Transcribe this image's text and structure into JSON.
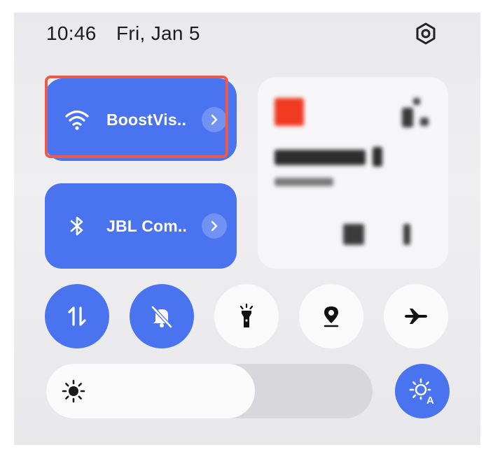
{
  "status": {
    "time": "10:46",
    "date": "Fri, Jan 5"
  },
  "icons": {
    "settings": "gear-icon",
    "wifi": "wifi-icon",
    "bluetooth": "bluetooth-icon",
    "data": "mobile-data-icon",
    "mute": "bell-off-icon",
    "flashlight": "flashlight-icon",
    "location": "location-pin-icon",
    "airplane": "airplane-icon",
    "brightness": "sun-icon",
    "auto_brightness": "auto-brightness-icon"
  },
  "tiles": {
    "wifi": {
      "label": "BoostVis.."
    },
    "bluetooth": {
      "label": "JBL Com.."
    }
  },
  "toggles": [
    {
      "name": "mobile-data",
      "active": true
    },
    {
      "name": "silent-mode",
      "active": true
    },
    {
      "name": "flashlight",
      "active": false
    },
    {
      "name": "location",
      "active": false
    },
    {
      "name": "airplane-mode",
      "active": false
    }
  ],
  "brightness": {
    "level": 0.64
  },
  "colors": {
    "accent": "#4a73f0",
    "highlight": "#ee5a48",
    "panel": "#ececef"
  }
}
